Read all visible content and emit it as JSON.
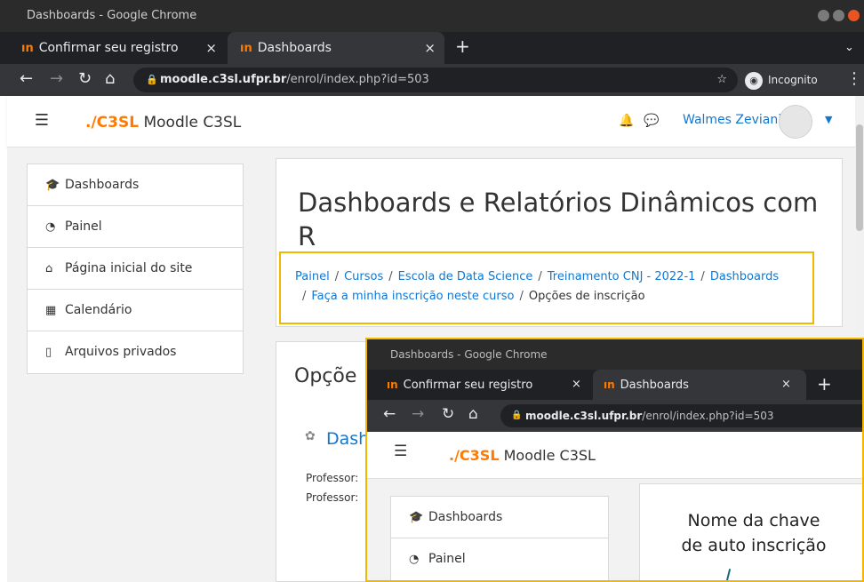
{
  "window": {
    "title": "Dashboards - Google Chrome"
  },
  "tabs": [
    {
      "label": "Confirmar seu registro",
      "favicon": "ın"
    },
    {
      "label": "Dashboards",
      "favicon": "ın"
    }
  ],
  "toolbar": {
    "url_host": "moodle.c3sl.ufpr.br",
    "url_path": "/enrol/index.php?id=503",
    "incognito_label": "Incognito"
  },
  "moodle": {
    "brand_logo": "./C3SL",
    "brand_name": "Moodle C3SL",
    "user_name": "Walmes Zeviani"
  },
  "nav": [
    {
      "label": "Dashboards",
      "icon": "graduation-cap-icon"
    },
    {
      "label": "Painel",
      "icon": "dashboard-icon"
    },
    {
      "label": "Página inicial do site",
      "icon": "home-icon"
    },
    {
      "label": "Calendário",
      "icon": "calendar-icon"
    },
    {
      "label": "Arquivos privados",
      "icon": "file-icon"
    }
  ],
  "page": {
    "title": "Dashboards e Relatórios Dinâmicos com R",
    "breadcrumb": [
      "Painel",
      "Cursos",
      "Escola de Data Science",
      "Treinamento CNJ - 2022-1",
      "Dashboards",
      "Faça a minha inscrição neste curso",
      "Opções de inscrição"
    ],
    "section_heading": "Opçõe",
    "course_name": "Dash",
    "professor_label_1": "Professor:",
    "professor_label_2": "Professor:"
  },
  "inset": {
    "window_title": "Dashboards - Google Chrome",
    "tab1": "Confirmar seu registro",
    "tab2": "Dashboards",
    "url_host": "moodle.c3sl.ufpr.br",
    "url_path": "/enrol/index.php?id=503",
    "brand_logo": "./C3SL",
    "brand_name": "Moodle C3SL",
    "nav1": "Dashboards",
    "nav2": "Painel",
    "annotation_line1": "Nome da chave",
    "annotation_line2": "de auto inscrição"
  },
  "colors": {
    "accent": "#1177d1",
    "highlight": "#f2b705",
    "brand": "#ff7a00"
  }
}
